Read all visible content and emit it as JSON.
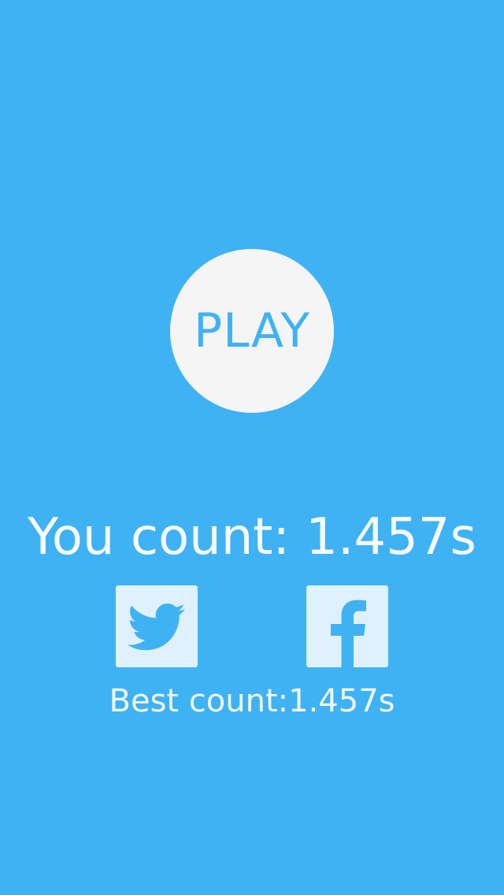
{
  "app": {
    "background_color": "#3fb2f3"
  },
  "play_button": {
    "label": "PLAY",
    "color": "#f5f5f5",
    "text_color": "#3fb2f3"
  },
  "score": {
    "text": "You count: 1.457s"
  },
  "share": {
    "twitter_icon": "twitter-bird-icon",
    "facebook_icon": "facebook-f-icon",
    "tile_color": "#dff1fd",
    "glyph_color": "#3fb2f3"
  },
  "best": {
    "text": "Best count:1.457s"
  }
}
